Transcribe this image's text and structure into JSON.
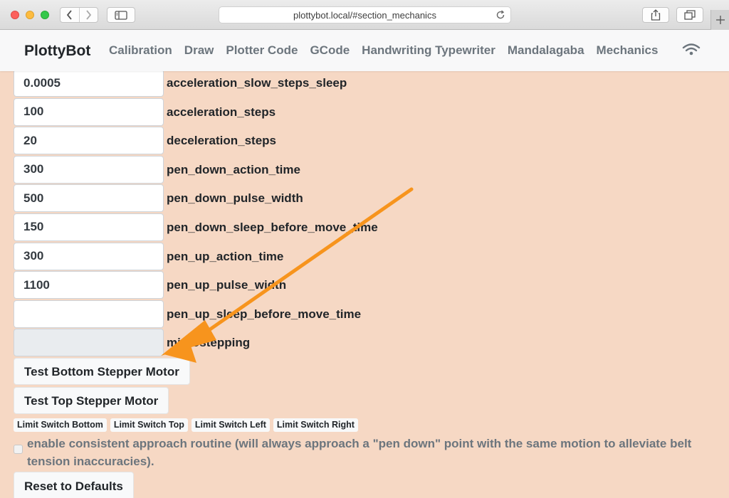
{
  "browser": {
    "url": "plottybot.local/#section_mechanics"
  },
  "navbar": {
    "brand": "PlottyBot",
    "links": [
      {
        "label": "Calibration"
      },
      {
        "label": "Draw"
      },
      {
        "label": "Plotter Code"
      },
      {
        "label": "GCode"
      },
      {
        "label": "Handwriting Typewriter"
      },
      {
        "label": "Mandalagaba"
      },
      {
        "label": "Mechanics"
      }
    ]
  },
  "fields": [
    {
      "value": "0.0005",
      "label": "acceleration_slow_steps_sleep"
    },
    {
      "value": "100",
      "label": "acceleration_steps"
    },
    {
      "value": "20",
      "label": "deceleration_steps"
    },
    {
      "value": "300",
      "label": "pen_down_action_time"
    },
    {
      "value": "500",
      "label": "pen_down_pulse_width"
    },
    {
      "value": "150",
      "label": "pen_down_sleep_before_move_time"
    },
    {
      "value": "300",
      "label": "pen_up_action_time"
    },
    {
      "value": "1100",
      "label": "pen_up_pulse_width"
    },
    {
      "value": "",
      "label": "pen_up_sleep_before_move_time"
    },
    {
      "value": "",
      "label": "microstepping"
    }
  ],
  "buttons": {
    "test_bottom": "Test Bottom Stepper Motor",
    "test_top": "Test Top Stepper Motor",
    "reset": "Reset to Defaults"
  },
  "limit_switches": [
    {
      "label": "Limit Switch Bottom"
    },
    {
      "label": "Limit Switch Top"
    },
    {
      "label": "Limit Switch Left"
    },
    {
      "label": "Limit Switch Right"
    }
  ],
  "approach": {
    "label": "enable consistent approach routine (will always approach a \"pen down\" point with the same motion to alleviate belt tension inaccuracies).",
    "checked": false
  },
  "colors": {
    "page_background": "#f6d8c4",
    "annotation_arrow": "#f7941d"
  }
}
